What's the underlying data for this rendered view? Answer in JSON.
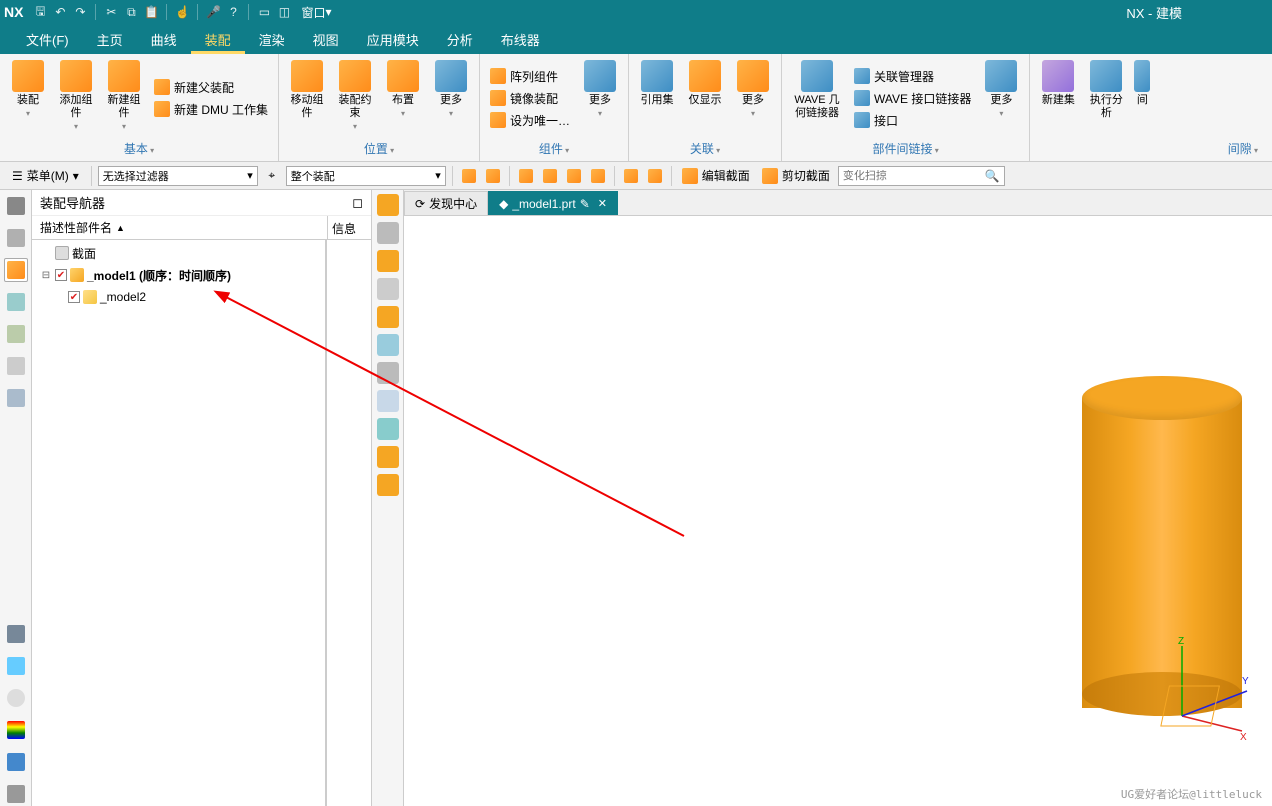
{
  "app": {
    "logo": "NX",
    "title": "NX - 建模"
  },
  "qat": {
    "window_menu": "窗口"
  },
  "menu": {
    "tabs": [
      "文件(F)",
      "主页",
      "曲线",
      "装配",
      "渲染",
      "视图",
      "应用模块",
      "分析",
      "布线器"
    ],
    "active_index": 3
  },
  "ribbon": {
    "groups": [
      {
        "label": "基本",
        "big": [
          {
            "txt": "装配"
          },
          {
            "txt": "添加组件"
          },
          {
            "txt": "新建组件"
          }
        ],
        "small": [
          {
            "txt": "新建父装配"
          },
          {
            "txt": "新建 DMU 工作集"
          }
        ]
      },
      {
        "label": "位置",
        "big": [
          {
            "txt": "移动组件"
          },
          {
            "txt": "装配约束"
          },
          {
            "txt": "布置"
          },
          {
            "txt": "更多"
          }
        ]
      },
      {
        "label": "组件",
        "small": [
          {
            "txt": "阵列组件"
          },
          {
            "txt": "镜像装配"
          },
          {
            "txt": "设为唯一…"
          }
        ],
        "big_after": [
          {
            "txt": "更多"
          }
        ]
      },
      {
        "label": "关联",
        "big": [
          {
            "txt": "引用集"
          },
          {
            "txt": "仅显示"
          },
          {
            "txt": "更多"
          }
        ]
      },
      {
        "label": "部件间链接",
        "big": [
          {
            "txt": "WAVE 几何链接器"
          }
        ],
        "small": [
          {
            "txt": "关联管理器"
          },
          {
            "txt": "WAVE 接口链接器"
          },
          {
            "txt": "接口"
          }
        ],
        "big_after": [
          {
            "txt": "更多"
          }
        ]
      },
      {
        "label": "间隙",
        "big": [
          {
            "txt": "新建集"
          },
          {
            "txt": "执行分析"
          },
          {
            "txt": "间"
          }
        ]
      }
    ]
  },
  "selbar": {
    "menu_label": "菜单(M)",
    "filter": "无选择过滤器",
    "scope": "整个装配",
    "edit_section": "编辑截面",
    "cut_section": "剪切截面",
    "search_placeholder": "变化扫掠"
  },
  "nav": {
    "title": "装配导航器",
    "col1": "描述性部件名",
    "col2": "信息",
    "tree": {
      "section": "截面",
      "root": "_model1  (顺序：时间顺序)",
      "child": "_model2"
    }
  },
  "tabs": {
    "discover": "发现中心",
    "model": "_model1.prt"
  },
  "watermark": "UG爱好者论坛@littleluck"
}
